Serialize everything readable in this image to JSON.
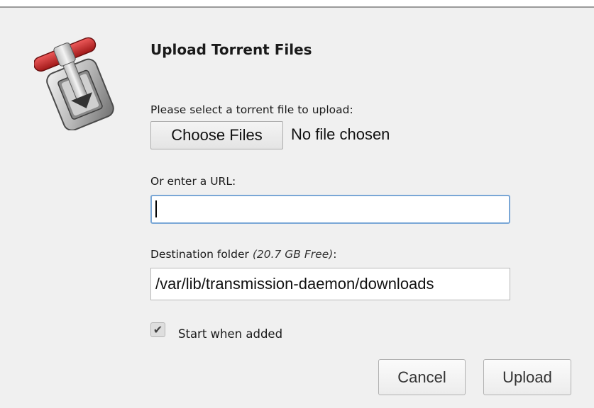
{
  "dialog": {
    "title": "Upload Torrent Files",
    "logo_icon": "transmission-logo-icon"
  },
  "file_upload": {
    "label": "Please select a torrent file to upload:",
    "button_label": "Choose Files",
    "status": "No file chosen"
  },
  "url": {
    "label": "Or enter a URL:",
    "value": ""
  },
  "destination": {
    "label": "Destination folder",
    "free_space": "(20.7 GB Free)",
    "label_suffix": ":",
    "value": "/var/lib/transmission-daemon/downloads"
  },
  "start_when_added": {
    "label": "Start when added",
    "checked": true
  },
  "buttons": {
    "cancel": "Cancel",
    "upload": "Upload"
  },
  "colors": {
    "background": "#f0f0f0",
    "url_focus_border": "#7aa7d6",
    "logo_red": "#cc2a2a"
  }
}
